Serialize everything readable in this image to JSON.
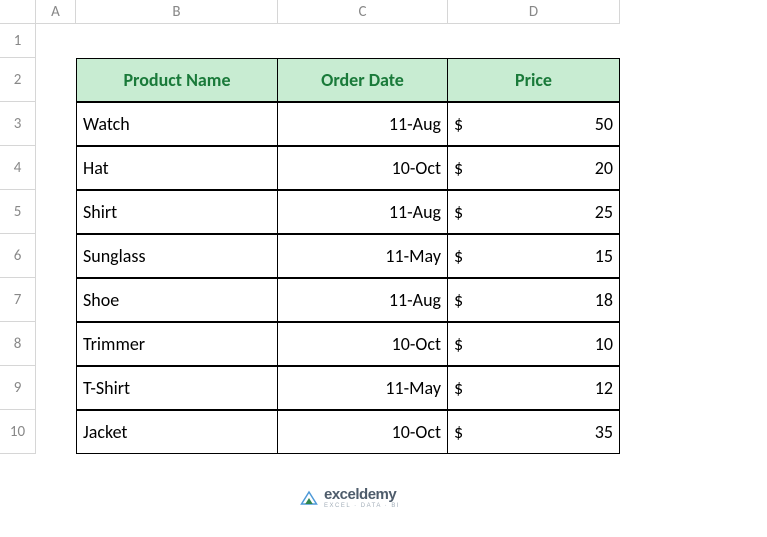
{
  "columns": [
    "A",
    "B",
    "C",
    "D"
  ],
  "rowNumbers": [
    "1",
    "2",
    "3",
    "4",
    "5",
    "6",
    "7",
    "8",
    "9",
    "10"
  ],
  "headers": {
    "product": "Product Name",
    "date": "Order Date",
    "price": "Price"
  },
  "currencySymbol": "$",
  "rows": [
    {
      "product": "Watch",
      "date": "11-Aug",
      "price": "50"
    },
    {
      "product": "Hat",
      "date": "10-Oct",
      "price": "20"
    },
    {
      "product": "Shirt",
      "date": "11-Aug",
      "price": "25"
    },
    {
      "product": "Sunglass",
      "date": "11-May",
      "price": "15"
    },
    {
      "product": "Shoe",
      "date": "11-Aug",
      "price": "18"
    },
    {
      "product": "Trimmer",
      "date": "10-Oct",
      "price": "10"
    },
    {
      "product": "T-Shirt",
      "date": "11-May",
      "price": "12"
    },
    {
      "product": "Jacket",
      "date": "10-Oct",
      "price": "35"
    }
  ],
  "watermark": {
    "main": "exceldemy",
    "sub": "EXCEL · DATA · BI"
  },
  "chart_data": {
    "type": "table",
    "title": "",
    "columns": [
      "Product Name",
      "Order Date",
      "Price"
    ],
    "data": [
      [
        "Watch",
        "11-Aug",
        50
      ],
      [
        "Hat",
        "10-Oct",
        20
      ],
      [
        "Shirt",
        "11-Aug",
        25
      ],
      [
        "Sunglass",
        "11-May",
        15
      ],
      [
        "Shoe",
        "11-Aug",
        18
      ],
      [
        "Trimmer",
        "10-Oct",
        10
      ],
      [
        "T-Shirt",
        "11-May",
        12
      ],
      [
        "Jacket",
        "10-Oct",
        35
      ]
    ]
  }
}
